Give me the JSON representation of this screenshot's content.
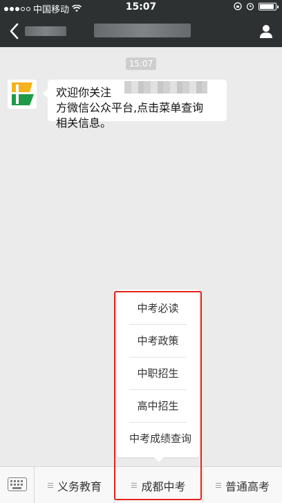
{
  "status_bar": {
    "carrier": "中国移动",
    "time": "15:07",
    "icons": [
      "signal-dots",
      "wifi-icon",
      "lock-rotation-icon",
      "alarm-icon",
      "battery-icon"
    ]
  },
  "nav": {
    "icons": [
      "back-chevron-icon",
      "person-icon"
    ]
  },
  "chat": {
    "timestamp": "15:07",
    "message_line1": "欢迎你关注",
    "message_line2": "方微信公众平台,点击菜单查询",
    "message_line3": "相关信息。"
  },
  "popup_menu": {
    "items": [
      {
        "label": "中考必读"
      },
      {
        "label": "中考政策"
      },
      {
        "label": "中职招生"
      },
      {
        "label": "高中招生"
      },
      {
        "label": "中考成绩查询"
      }
    ]
  },
  "bottom_menu": {
    "tabs": [
      {
        "label": "义务教育"
      },
      {
        "label": "成都中考"
      },
      {
        "label": "普通高考"
      }
    ]
  },
  "colors": {
    "header_bg": "#2e3132",
    "chat_bg": "#ebebeb",
    "highlight": "#e2231a",
    "logo_yellow": "#f5b21b",
    "logo_green": "#1f9a48"
  }
}
